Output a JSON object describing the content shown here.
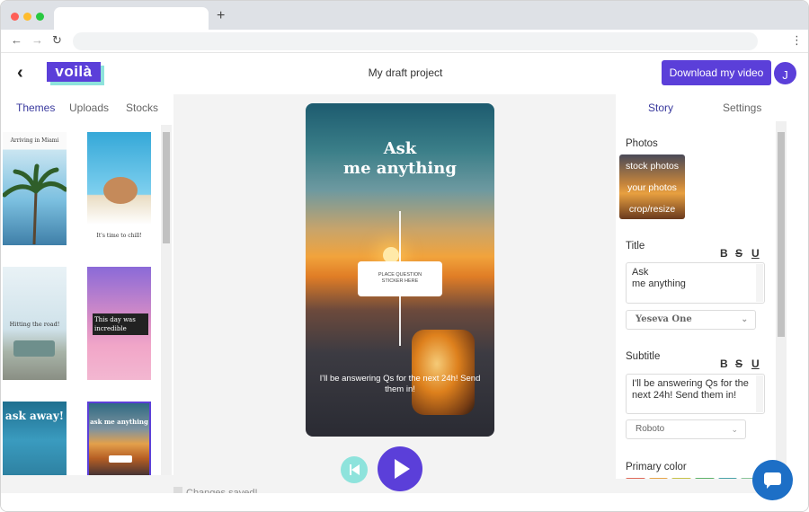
{
  "header": {
    "logo": "voilà",
    "project_title": "My draft project",
    "download_label": "Download my video",
    "avatar_initial": "J"
  },
  "left_panel": {
    "tabs": [
      "Themes",
      "Uploads",
      "Stocks"
    ],
    "themes": [
      {
        "text": "Arriving in Miami"
      },
      {
        "text": "It's time to chill!"
      },
      {
        "text": "Hitting the road!"
      },
      {
        "text": "This day was incredible"
      },
      {
        "text": "ask away!"
      },
      {
        "text": "ask me anything"
      }
    ]
  },
  "canvas": {
    "title_line1": "Ask",
    "title_line2": "me anything",
    "sticker_line1": "PLACE QUESTION",
    "sticker_line2": "STICKER HERE",
    "subtitle": "I'll be answering Qs for the next 24h! Send them in!",
    "status": "Changes saved!"
  },
  "right_panel": {
    "tabs": [
      "Story",
      "Settings"
    ],
    "photos_label": "Photos",
    "photo_options": [
      "stock photos",
      "your photos",
      "crop/resize"
    ],
    "title_label": "Title",
    "title_value_line1": "Ask",
    "title_value_line2": "me anything",
    "title_font": "Yeseva One",
    "subtitle_label": "Subtitle",
    "subtitle_value": "I'll be answering Qs for the next 24h! Send them in!",
    "subtitle_font": "Roboto",
    "primary_color_label": "Primary color",
    "format_buttons": [
      "B",
      "S",
      "U"
    ]
  },
  "colors": {
    "brand": "#5b3fd9",
    "accent": "#8ee3dc",
    "chat": "#1d6fc6"
  }
}
